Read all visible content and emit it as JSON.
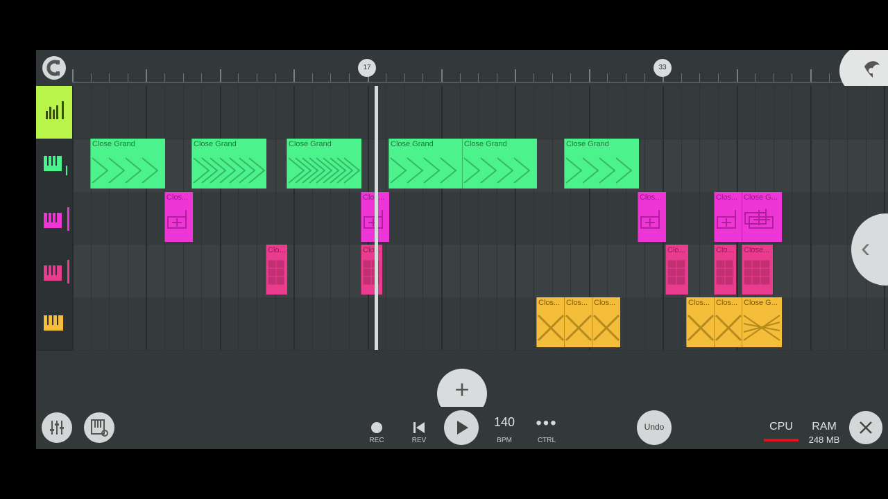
{
  "timeline": {
    "markers": [
      "17",
      "33"
    ]
  },
  "tracks": [
    {
      "name": "playlist-header",
      "color": "#b8f44a"
    },
    {
      "name": "close-grand-1",
      "color": "#4cf28c"
    },
    {
      "name": "close-grand-2",
      "color": "#ee35d6"
    },
    {
      "name": "close-grand-3",
      "color": "#ea3c8e"
    },
    {
      "name": "close-grand-4",
      "color": "#f4bd3a"
    }
  ],
  "clips": {
    "green": [
      "Close Grand",
      "Close Grand",
      "Close Grand",
      "Close Grand",
      "Close Grand",
      "Close Grand"
    ],
    "magenta": [
      "Clos...",
      "Clos...",
      "Clos...",
      "Clos...",
      "Close G..."
    ],
    "pink": [
      "Clo...",
      "Clo...",
      "Clo...",
      "Clo...",
      "Close..."
    ],
    "yellow": [
      "Clos...",
      "Clos...",
      "Clos...",
      "Clos...",
      "Clos...",
      "Close G..."
    ]
  },
  "toolbar": {
    "rec": "REC",
    "rev": "REV",
    "bpm_value": "140",
    "bpm_label": "BPM",
    "ctrl": "CTRL",
    "undo": "Undo",
    "cpu": "CPU",
    "ram": "RAM",
    "ram_value": "248 MB"
  }
}
